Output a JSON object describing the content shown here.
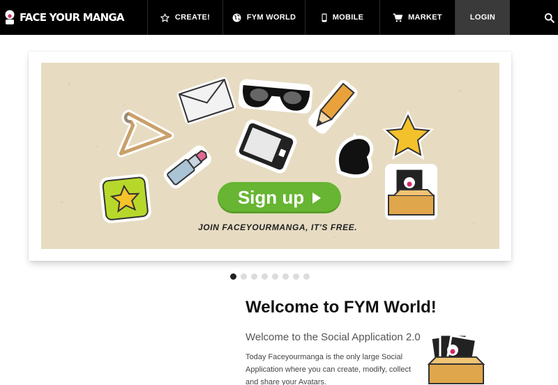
{
  "nav": {
    "logo": "FACE YOUR MANGA",
    "create": "CREATE!",
    "world": "FYM WORLD",
    "mobile": "MOBILE",
    "market": "MARKET",
    "login": "LOGIN"
  },
  "banner": {
    "signup_label": "Sign up",
    "tagline": "JOIN FACEYOURMANGA, IT'S FREE."
  },
  "slider": {
    "total_slides": 8,
    "active_slide": 1
  },
  "welcome": {
    "title": "Welcome to FYM World!",
    "subtitle": "Welcome to the Social Application 2.0",
    "body": "Today Faceyourmanga is the only large Social Application where you can create, modify, collect and share your Avatars."
  },
  "colors": {
    "navbar": "#000000",
    "login_bg": "#3a3a3a",
    "banner_bg": "#e7dcc2",
    "signup_green": "#67b532",
    "active_dot": "#222222"
  },
  "icons": [
    "logo-icon",
    "star-icon",
    "globe-icon",
    "phone-icon",
    "cart-icon",
    "search-icon",
    "play-arrow-icon"
  ]
}
